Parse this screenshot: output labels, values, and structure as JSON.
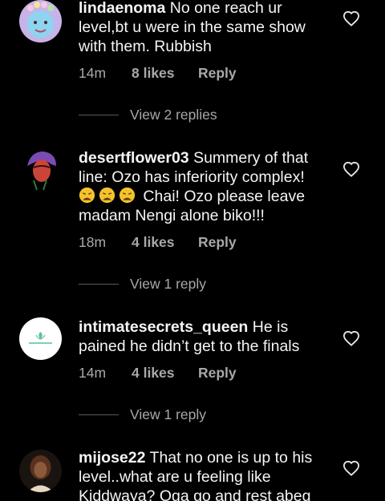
{
  "comments": [
    {
      "username": "lindaenoma",
      "text": " No one reach ur level,bt u were in the same show with them. Rubbish",
      "time": "14m",
      "likes": "8 likes",
      "reply": "Reply",
      "view_replies": "View 2 replies"
    },
    {
      "username": "desertflower03",
      "text": " Summery of that line: Ozo has inferiority complex!",
      "text_after_emoji": "Chai! Ozo please leave madam Nengi alone biko!!!",
      "time": "18m",
      "likes": "4 likes",
      "reply": "Reply",
      "view_replies": "View 1 reply"
    },
    {
      "username": "intimatesecrets_queen",
      "text": " He is pained he didn’t get to the finals",
      "time": "14m",
      "likes": "4 likes",
      "reply": "Reply",
      "view_replies": "View 1 reply"
    },
    {
      "username": "mijose22",
      "text": " That no one is up to his level..what are u feeling like Kiddwaya? Oga go and rest abeg"
    }
  ],
  "colors": {
    "background": "#000000",
    "text": "#f5f5f5",
    "secondary": "#a8a8a8"
  },
  "icons": {
    "like": "heart-outline-icon",
    "emoji": "weary-face-emoji"
  }
}
